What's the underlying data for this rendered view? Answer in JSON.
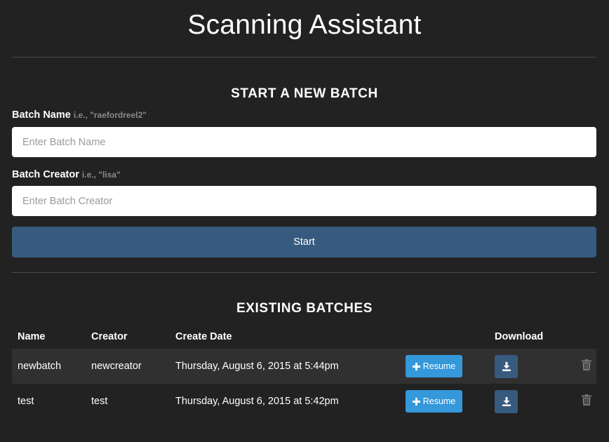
{
  "app": {
    "title": "Scanning Assistant"
  },
  "new_batch": {
    "heading": "START A NEW BATCH",
    "name_label": "Batch Name",
    "name_hint": "i.e., \"raefordreel2\"",
    "name_placeholder": "Enter Batch Name",
    "name_value": "",
    "creator_label": "Batch Creator",
    "creator_hint": "i.e., \"lisa\"",
    "creator_placeholder": "Enter Batch Creator",
    "creator_value": "",
    "start_label": "Start"
  },
  "existing": {
    "heading": "EXISTING BATCHES",
    "columns": {
      "name": "Name",
      "creator": "Creator",
      "create_date": "Create Date",
      "download": "Download"
    },
    "rows": [
      {
        "name": "newbatch",
        "creator": "newcreator",
        "create_date": "Thursday, August 6, 2015 at 5:44pm",
        "resume_label": "Resume"
      },
      {
        "name": "test",
        "creator": "test",
        "create_date": "Thursday, August 6, 2015 at 5:42pm",
        "resume_label": "Resume"
      }
    ]
  },
  "icons": {
    "resume": "plus-icon",
    "download": "download-icon",
    "delete": "trash-icon"
  },
  "colors": {
    "background": "#222222",
    "primary": "#375a7f",
    "info": "#3498db",
    "row_stripe": "#303030",
    "hint_text": "#8a8a8a"
  }
}
